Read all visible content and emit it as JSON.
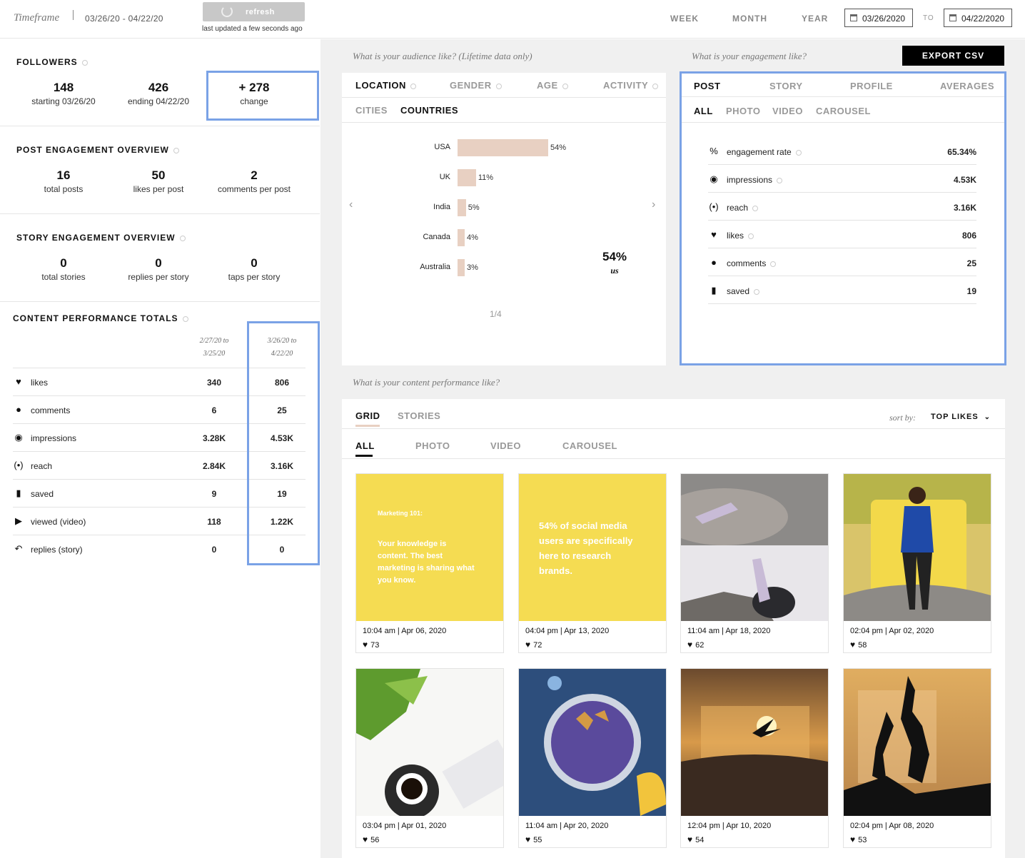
{
  "header": {
    "timeframe_label": "Timeframe",
    "range": "03/26/20 - 04/22/20",
    "refresh_label": "refresh",
    "updated": "last updated a few seconds ago",
    "periods": [
      "WEEK",
      "MONTH",
      "YEAR"
    ],
    "date_from": "03/26/2020",
    "to_label": "TO",
    "date_to": "04/22/2020"
  },
  "followers": {
    "title": "FOLLOWERS",
    "starting_value": "148",
    "starting_label": "starting 03/26/20",
    "ending_value": "426",
    "ending_label": "ending 04/22/20",
    "change_value": "+ 278",
    "change_label": "change"
  },
  "post_engagement": {
    "title": "POST ENGAGEMENT OVERVIEW",
    "stats": [
      {
        "value": "16",
        "label": "total posts"
      },
      {
        "value": "50",
        "label": "likes per post"
      },
      {
        "value": "2",
        "label": "comments per post"
      }
    ]
  },
  "story_engagement": {
    "title": "STORY ENGAGEMENT OVERVIEW",
    "stats": [
      {
        "value": "0",
        "label": "total stories"
      },
      {
        "value": "0",
        "label": "replies per story"
      },
      {
        "value": "0",
        "label": "taps per story"
      }
    ]
  },
  "content_totals": {
    "title": "CONTENT PERFORMANCE TOTALS",
    "col1_line1": "2/27/20 to",
    "col1_line2": "3/25/20",
    "col2_line1": "3/26/20 to",
    "col2_line2": "4/22/20",
    "rows": [
      {
        "icon": "heart-icon",
        "label": "likes",
        "prev": "340",
        "curr": "806"
      },
      {
        "icon": "comment-icon",
        "label": "comments",
        "prev": "6",
        "curr": "25"
      },
      {
        "icon": "eye-icon",
        "label": "impressions",
        "prev": "3.28K",
        "curr": "4.53K"
      },
      {
        "icon": "broadcast-icon",
        "label": "reach",
        "prev": "2.84K",
        "curr": "3.16K"
      },
      {
        "icon": "bookmark-icon",
        "label": "saved",
        "prev": "9",
        "curr": "19"
      },
      {
        "icon": "play-icon",
        "label": "viewed (video)",
        "prev": "118",
        "curr": "1.22K"
      },
      {
        "icon": "reply-icon",
        "label": "replies (story)",
        "prev": "0",
        "curr": "0"
      }
    ]
  },
  "audience": {
    "question": "What is your audience like? (Lifetime data only)",
    "tabs": [
      "LOCATION",
      "GENDER",
      "AGE",
      "ACTIVITY"
    ],
    "subtabs": [
      "CITIES",
      "COUNTRIES"
    ],
    "big_value": "54%",
    "big_label": "us",
    "page": "1/4"
  },
  "chart_data": {
    "type": "bar",
    "categories": [
      "USA",
      "UK",
      "India",
      "Canada",
      "Australia"
    ],
    "values": [
      54,
      11,
      5,
      4,
      3
    ],
    "data_labels": [
      "54%",
      "11%",
      "5%",
      "4%",
      "3%"
    ],
    "color": "#e8d0c2"
  },
  "engagement": {
    "question": "What is your engagement like?",
    "export_label": "EXPORT CSV",
    "tabs": [
      "POST",
      "STORY",
      "PROFILE",
      "AVERAGES"
    ],
    "subtabs": [
      "ALL",
      "PHOTO",
      "VIDEO",
      "CAROUSEL"
    ],
    "rows": [
      {
        "icon": "percent-icon",
        "label": "engagement rate",
        "value": "65.34%"
      },
      {
        "icon": "eye-icon",
        "label": "impressions",
        "value": "4.53K"
      },
      {
        "icon": "broadcast-icon",
        "label": "reach",
        "value": "3.16K"
      },
      {
        "icon": "heart-icon",
        "label": "likes",
        "value": "806"
      },
      {
        "icon": "comment-icon",
        "label": "comments",
        "value": "25"
      },
      {
        "icon": "bookmark-icon",
        "label": "saved",
        "value": "19"
      }
    ]
  },
  "content": {
    "question": "What is your content performance like?",
    "tabs": [
      "GRID",
      "STORIES"
    ],
    "sort_label": "sort by:",
    "sort_value": "TOP LIKES",
    "subtabs": [
      "ALL",
      "PHOTO",
      "VIDEO",
      "CAROUSEL"
    ],
    "posts": [
      {
        "date": "10:04 am | Apr 06, 2020",
        "likes": "73",
        "img_text1": "Marketing 101:",
        "img_text2": "Your knowledge is content. The best marketing is sharing what you know."
      },
      {
        "date": "04:04 pm | Apr 13, 2020",
        "likes": "72",
        "img_text1": "54% of social media users are specifically here to research brands.",
        "img_text2": ""
      },
      {
        "date": "11:04 am | Apr 18, 2020",
        "likes": "62"
      },
      {
        "date": "02:04 pm | Apr 02, 2020",
        "likes": "58"
      },
      {
        "date": "03:04 pm | Apr 01, 2020",
        "likes": "56"
      },
      {
        "date": "11:04 am | Apr 20, 2020",
        "likes": "55"
      },
      {
        "date": "12:04 pm | Apr 10, 2020",
        "likes": "54"
      },
      {
        "date": "02:04 pm | Apr 08, 2020",
        "likes": "53"
      }
    ]
  }
}
